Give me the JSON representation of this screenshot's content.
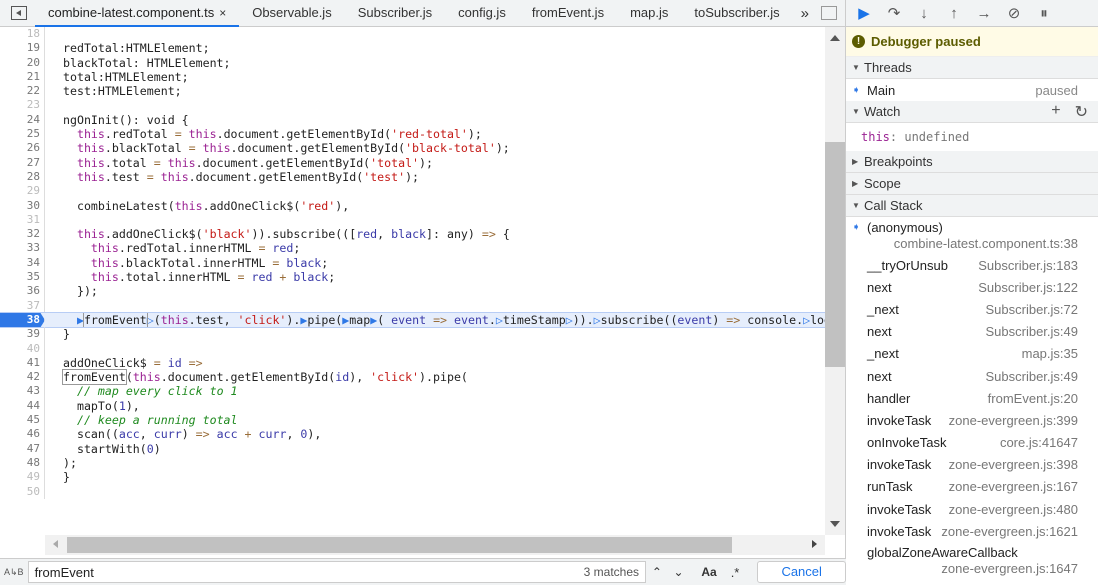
{
  "tabs": [
    "combine-latest.component.ts",
    "Observable.js",
    "Subscriber.js",
    "config.js",
    "fromEvent.js",
    "map.js",
    "toSubscriber.js"
  ],
  "tab_close": "×",
  "tab_more": "»",
  "code": [
    {
      "n": 18,
      "t": []
    },
    {
      "n": 19,
      "t": [
        [
          "redTotal:HTMLElement;",
          ""
        ]
      ]
    },
    {
      "n": 20,
      "t": [
        [
          "blackTotal: HTMLElement;",
          ""
        ]
      ]
    },
    {
      "n": 21,
      "t": [
        [
          "total:HTMLElement;",
          ""
        ]
      ]
    },
    {
      "n": 22,
      "t": [
        [
          "test:HTMLElement;",
          ""
        ]
      ]
    },
    {
      "n": 23,
      "t": []
    },
    {
      "n": 24,
      "t": [
        [
          "ngOnInit(): void {",
          ""
        ]
      ]
    },
    {
      "n": 25,
      "t": [
        [
          "  ",
          ""
        ],
        [
          "this",
          "k"
        ],
        [
          ".redTotal ",
          ""
        ],
        [
          "=",
          "o"
        ],
        [
          " ",
          ""
        ],
        [
          "this",
          "k"
        ],
        [
          ".document.getElementById(",
          ""
        ],
        [
          "'red-total'",
          "s"
        ],
        [
          ");",
          ""
        ]
      ]
    },
    {
      "n": 26,
      "t": [
        [
          "  ",
          ""
        ],
        [
          "this",
          "k"
        ],
        [
          ".blackTotal ",
          ""
        ],
        [
          "=",
          "o"
        ],
        [
          " ",
          ""
        ],
        [
          "this",
          "k"
        ],
        [
          ".document.getElementById(",
          ""
        ],
        [
          "'black-total'",
          "s"
        ],
        [
          ");",
          ""
        ]
      ]
    },
    {
      "n": 27,
      "t": [
        [
          "  ",
          ""
        ],
        [
          "this",
          "k"
        ],
        [
          ".total ",
          ""
        ],
        [
          "=",
          "o"
        ],
        [
          " ",
          ""
        ],
        [
          "this",
          "k"
        ],
        [
          ".document.getElementById(",
          ""
        ],
        [
          "'total'",
          "s"
        ],
        [
          ");",
          ""
        ]
      ]
    },
    {
      "n": 28,
      "t": [
        [
          "  ",
          ""
        ],
        [
          "this",
          "k"
        ],
        [
          ".test ",
          ""
        ],
        [
          "=",
          "o"
        ],
        [
          " ",
          ""
        ],
        [
          "this",
          "k"
        ],
        [
          ".document.getElementById(",
          ""
        ],
        [
          "'test'",
          "s"
        ],
        [
          ");",
          ""
        ]
      ]
    },
    {
      "n": 29,
      "t": []
    },
    {
      "n": 30,
      "t": [
        [
          "  combineLatest(",
          ""
        ],
        [
          "this",
          "k"
        ],
        [
          ".addOneClick$(",
          ""
        ],
        [
          "'red'",
          "s"
        ],
        [
          "),",
          ""
        ]
      ]
    },
    {
      "n": 31,
      "t": []
    },
    {
      "n": 32,
      "t": [
        [
          "  ",
          ""
        ],
        [
          "this",
          "k"
        ],
        [
          ".addOneClick$(",
          ""
        ],
        [
          "'black'",
          "s"
        ],
        [
          ")).subscribe(([",
          ""
        ],
        [
          "red",
          "v"
        ],
        [
          ", ",
          ""
        ],
        [
          "black",
          "v"
        ],
        [
          "]: any) ",
          ""
        ],
        [
          "=>",
          "o"
        ],
        [
          " {",
          ""
        ]
      ]
    },
    {
      "n": 33,
      "t": [
        [
          "    ",
          ""
        ],
        [
          "this",
          "k"
        ],
        [
          ".redTotal.innerHTML ",
          ""
        ],
        [
          "=",
          "o"
        ],
        [
          " ",
          ""
        ],
        [
          "red",
          "v"
        ],
        [
          ";",
          ""
        ]
      ]
    },
    {
      "n": 34,
      "t": [
        [
          "    ",
          ""
        ],
        [
          "this",
          "k"
        ],
        [
          ".blackTotal.innerHTML ",
          ""
        ],
        [
          "=",
          "o"
        ],
        [
          " ",
          ""
        ],
        [
          "black",
          "v"
        ],
        [
          ";",
          ""
        ]
      ]
    },
    {
      "n": 35,
      "t": [
        [
          "    ",
          ""
        ],
        [
          "this",
          "k"
        ],
        [
          ".total.innerHTML ",
          ""
        ],
        [
          "=",
          "o"
        ],
        [
          " ",
          ""
        ],
        [
          "red",
          "v"
        ],
        [
          " ",
          ""
        ],
        [
          "+",
          "o"
        ],
        [
          " ",
          ""
        ],
        [
          "black",
          "v"
        ],
        [
          ";",
          ""
        ]
      ]
    },
    {
      "n": 36,
      "t": [
        [
          "  });",
          ""
        ]
      ]
    },
    {
      "n": 37,
      "t": []
    },
    {
      "n": 38,
      "hl": true,
      "t": [
        [
          "  ",
          ""
        ],
        [
          "▶",
          "bp"
        ],
        [
          "fromEvent",
          "box"
        ],
        [
          "▷",
          "bp"
        ],
        [
          "(",
          ""
        ],
        [
          "this",
          "k"
        ],
        [
          ".test, ",
          ""
        ],
        [
          "'click'",
          "s"
        ],
        [
          ").",
          ""
        ],
        [
          "▶",
          "bp"
        ],
        [
          "pipe(",
          ""
        ],
        [
          "▶",
          "bp"
        ],
        [
          "map",
          ""
        ],
        [
          "▶",
          "bp"
        ],
        [
          "( ",
          ""
        ],
        [
          "event",
          "v"
        ],
        [
          " ",
          ""
        ],
        [
          "=>",
          "o"
        ],
        [
          " ",
          ""
        ],
        [
          "event",
          "v"
        ],
        [
          ".",
          ""
        ],
        [
          "▷",
          "bp"
        ],
        [
          "timeStamp",
          ""
        ],
        [
          "▷",
          "bp"
        ],
        [
          ")).",
          ""
        ],
        [
          "▷",
          "bp"
        ],
        [
          "subscribe((",
          ""
        ],
        [
          "event",
          "v"
        ],
        [
          ") ",
          ""
        ],
        [
          "=>",
          "o"
        ],
        [
          " console.",
          ""
        ],
        [
          "▷",
          "bp"
        ],
        [
          "log",
          ""
        ]
      ]
    },
    {
      "n": 39,
      "t": [
        [
          "}",
          ""
        ]
      ]
    },
    {
      "n": 40,
      "t": []
    },
    {
      "n": 41,
      "t": [
        [
          "addOneClick$ ",
          ""
        ],
        [
          "=",
          "o"
        ],
        [
          " ",
          ""
        ],
        [
          "id",
          "v"
        ],
        [
          " ",
          ""
        ],
        [
          "=>",
          "o"
        ]
      ]
    },
    {
      "n": 42,
      "t": [
        [
          "fromEvent",
          "box"
        ],
        [
          "(",
          ""
        ],
        [
          "this",
          "k"
        ],
        [
          ".document.getElementById(",
          ""
        ],
        [
          "id",
          "v"
        ],
        [
          "), ",
          ""
        ],
        [
          "'click'",
          "s"
        ],
        [
          ").pipe(",
          ""
        ]
      ]
    },
    {
      "n": 43,
      "t": [
        [
          "  ",
          ""
        ],
        [
          "// map every click to 1",
          "c"
        ]
      ]
    },
    {
      "n": 44,
      "t": [
        [
          "  mapTo(",
          ""
        ],
        [
          "1",
          "n"
        ],
        [
          "),",
          ""
        ]
      ]
    },
    {
      "n": 45,
      "t": [
        [
          "  ",
          ""
        ],
        [
          "// keep a running total",
          "c"
        ]
      ]
    },
    {
      "n": 46,
      "t": [
        [
          "  scan((",
          ""
        ],
        [
          "acc",
          "v"
        ],
        [
          ", ",
          ""
        ],
        [
          "curr",
          "v"
        ],
        [
          ") ",
          ""
        ],
        [
          "=>",
          "o"
        ],
        [
          " ",
          ""
        ],
        [
          "acc",
          "v"
        ],
        [
          " ",
          ""
        ],
        [
          "+",
          "o"
        ],
        [
          " ",
          ""
        ],
        [
          "curr",
          "v"
        ],
        [
          ", ",
          ""
        ],
        [
          "0",
          "n"
        ],
        [
          "),",
          ""
        ]
      ]
    },
    {
      "n": 47,
      "t": [
        [
          "  startWith(",
          ""
        ],
        [
          "0",
          "n"
        ],
        [
          ")",
          ""
        ]
      ]
    },
    {
      "n": 48,
      "t": [
        [
          ");",
          ""
        ]
      ]
    },
    {
      "n": 49,
      "t": [
        [
          "}",
          ""
        ]
      ]
    },
    {
      "n": 50,
      "t": []
    }
  ],
  "search": {
    "value": "fromEvent",
    "matches": "3 matches",
    "case_label": "Aa",
    "regex_label": ".*",
    "cancel": "Cancel",
    "ab_label": "A↳B"
  },
  "debugger": {
    "paused_label": "Debugger paused",
    "threads_label": "Threads",
    "thread_name": "Main",
    "thread_status": "paused",
    "watch_label": "Watch",
    "watch_key": "this",
    "watch_value": ": undefined",
    "breakpoints_label": "Breakpoints",
    "scope_label": "Scope",
    "callstack_label": "Call Stack",
    "frames": [
      {
        "name": "(anonymous)",
        "loc": "combine-latest.component.ts:38",
        "current": true
      },
      {
        "name": "__tryOrUnsub",
        "loc": "Subscriber.js:183"
      },
      {
        "name": "next",
        "loc": "Subscriber.js:122"
      },
      {
        "name": "_next",
        "loc": "Subscriber.js:72"
      },
      {
        "name": "next",
        "loc": "Subscriber.js:49"
      },
      {
        "name": "_next",
        "loc": "map.js:35"
      },
      {
        "name": "next",
        "loc": "Subscriber.js:49"
      },
      {
        "name": "handler",
        "loc": "fromEvent.js:20"
      },
      {
        "name": "invokeTask",
        "loc": "zone-evergreen.js:399"
      },
      {
        "name": "onInvokeTask",
        "loc": "core.js:41647"
      },
      {
        "name": "invokeTask",
        "loc": "zone-evergreen.js:398"
      },
      {
        "name": "runTask",
        "loc": "zone-evergreen.js:167"
      },
      {
        "name": "invokeTask",
        "loc": "zone-evergreen.js:480"
      },
      {
        "name": "invokeTask",
        "loc": "zone-evergreen.js:1621"
      },
      {
        "name": "globalZoneAwareCallback",
        "loc": "zone-evergreen.js:1647",
        "wrap": true
      }
    ]
  }
}
